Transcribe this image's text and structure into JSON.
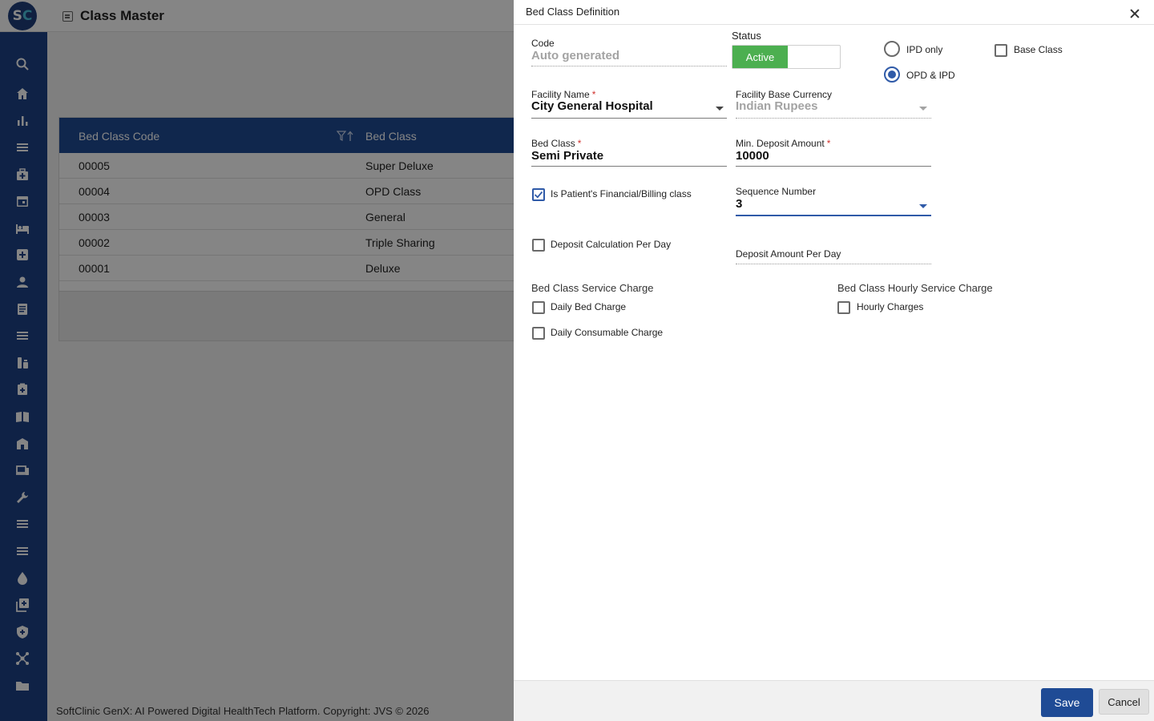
{
  "app": {
    "logo_text_left": "S",
    "logo_text_right": "C",
    "page_title": "Class Master",
    "footer": "SoftClinic GenX: AI Powered Digital HealthTech Platform. Copyright: JVS © 2026"
  },
  "sidebar": {
    "icons": [
      "search-icon",
      "home-icon",
      "chart-icon",
      "menu-icon",
      "medical-bag-icon",
      "calendar-icon",
      "bed-icon",
      "add-box-icon",
      "person-icon",
      "document-icon",
      "list-icon",
      "pharmacy-icon",
      "clipboard-icon",
      "book-icon",
      "building-icon",
      "devices-icon",
      "wrench-icon",
      "list-icon-2",
      "list-icon-3",
      "drop-icon",
      "add-library-icon",
      "shield-icon",
      "network-icon",
      "folder-icon"
    ]
  },
  "grid": {
    "columns": [
      "Bed Class Code",
      "Bed Class"
    ],
    "rows": [
      {
        "code": "00005",
        "name": "Super Deluxe"
      },
      {
        "code": "00004",
        "name": "OPD Class"
      },
      {
        "code": "00003",
        "name": "General"
      },
      {
        "code": "00002",
        "name": "Triple Sharing"
      },
      {
        "code": "00001",
        "name": "Deluxe"
      }
    ]
  },
  "dialog": {
    "title": "Bed Class Definition",
    "code": {
      "label": "Code",
      "placeholder": "Auto generated"
    },
    "status": {
      "label": "Status",
      "value": "Active"
    },
    "visit_type": {
      "options": [
        "IPD only",
        "OPD & IPD"
      ],
      "selected": "OPD & IPD"
    },
    "base_class": {
      "label": "Base Class",
      "checked": false
    },
    "facility": {
      "label": "Facility Name",
      "value": "City General Hospital"
    },
    "currency": {
      "label": "Facility Base Currency",
      "value": "Indian Rupees"
    },
    "bed_class": {
      "label": "Bed Class",
      "value": "Semi Private"
    },
    "min_deposit": {
      "label": "Min. Deposit Amount",
      "value": "10000"
    },
    "billing_class": {
      "label": "Is Patient's Financial/Billing class",
      "checked": true
    },
    "sequence": {
      "label": "Sequence Number",
      "value": "3"
    },
    "deposit_per_day": {
      "label": "Deposit Calculation Per Day",
      "checked": false
    },
    "deposit_amount_per_day": {
      "label": "Deposit Amount Per Day"
    },
    "service_charge": {
      "title": "Bed Class Service Charge",
      "options": [
        {
          "label": "Daily Bed Charge",
          "checked": false
        },
        {
          "label": "Daily Consumable Charge",
          "checked": false
        }
      ]
    },
    "hourly_charge": {
      "title": "Bed Class Hourly Service Charge",
      "options": [
        {
          "label": "Hourly Charges",
          "checked": false
        }
      ]
    },
    "save_label": "Save",
    "cancel_label": "Cancel"
  },
  "colors": {
    "brand_blue": "#1f4b95",
    "sidebar_blue": "#1e4186",
    "status_green": "#4caf50",
    "required_red": "#d0312d"
  }
}
